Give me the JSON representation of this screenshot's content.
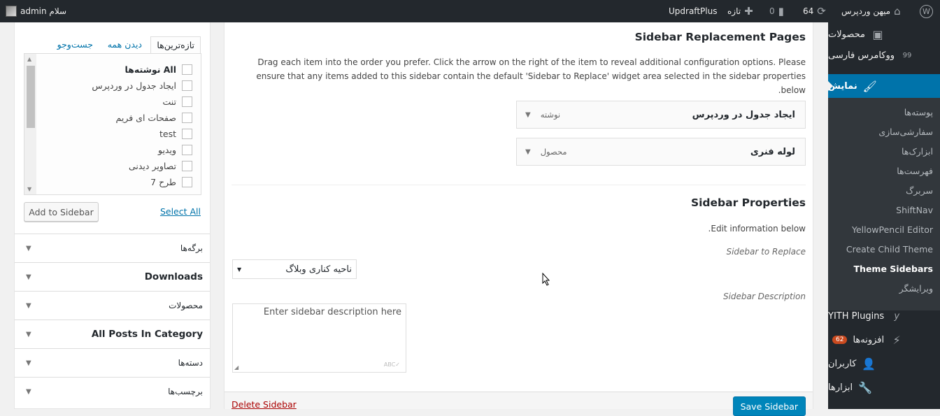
{
  "adminbar": {
    "greeting": "سلام admin",
    "site_name": "میهن وردپرس",
    "updates_count": "64",
    "comments_count": "0",
    "new_label": "تازه",
    "updraft_label": "UpdraftPlus",
    "icons": {
      "wp": "wordpress-icon",
      "home": "home-icon",
      "updates": "refresh-icon",
      "comments": "comment-icon",
      "new": "plus-icon"
    }
  },
  "menu": {
    "top_items": [
      {
        "label": "محصولات",
        "icon": "box-icon"
      },
      {
        "label": "ووکامرس فارسی",
        "icon": "ninety-nine-icon"
      },
      {
        "label": "نمایش",
        "icon": "paintbrush-icon"
      }
    ],
    "submenu": [
      "پوسته‌ها",
      "سفارشی‌سازی",
      "ابزارک‌ها",
      "فهرست‌ها",
      "سربرگ",
      "ShiftNav",
      "YellowPencil Editor",
      "Create Child Theme",
      "Theme Sidebars",
      "ویرایشگر"
    ],
    "bottom_items": [
      {
        "label": "YITH Plugins",
        "icon": "yith-icon"
      },
      {
        "label": "افزونه‌ها",
        "icon": "plugin-icon",
        "badge": "62"
      },
      {
        "label": "کاربران",
        "icon": "user-icon"
      },
      {
        "label": "ابزارها",
        "icon": "wrench-icon"
      }
    ]
  },
  "left": {
    "tabs": [
      "تازه‌ترین‌ها",
      "دیدن همه",
      "جست‌وجو"
    ],
    "items": [
      "All نوشته‌ها",
      "ایجاد جدول در وردپرس",
      "تنت",
      "صفحات ای فریم",
      "test",
      "ویدیو",
      "تصاویر دیدنی",
      "طرح 7"
    ],
    "add_button": "Add to Sidebar",
    "select_all": "Select All",
    "accordions": [
      "برگه‌ها",
      "Downloads",
      "محصولات",
      "All Posts In Category",
      "دسته‌ها",
      "برچسب‌ها"
    ]
  },
  "main": {
    "title": "Sidebar Replacement Pages",
    "description": "Drag each item into the order you prefer. Click the arrow on the right of the item to reveal additional configuration options. Please ensure that any items added to this sidebar contain the default 'Sidebar to Replace' widget area selected in the sidebar properties below.",
    "items": [
      {
        "title": "ایجاد جدول در وردپرس",
        "type": "نوشته"
      },
      {
        "title": "لوله فنری",
        "type": "محصول"
      }
    ],
    "properties_title": "Sidebar Properties",
    "edit_info": "Edit information below.",
    "replace_label": "Sidebar to Replace",
    "replace_value": "ناحیه کناری وبلاگ",
    "description_label": "Sidebar Description",
    "description_placeholder": "Enter sidebar description here",
    "delete_label": "Delete Sidebar",
    "save_label": "Save Sidebar"
  }
}
